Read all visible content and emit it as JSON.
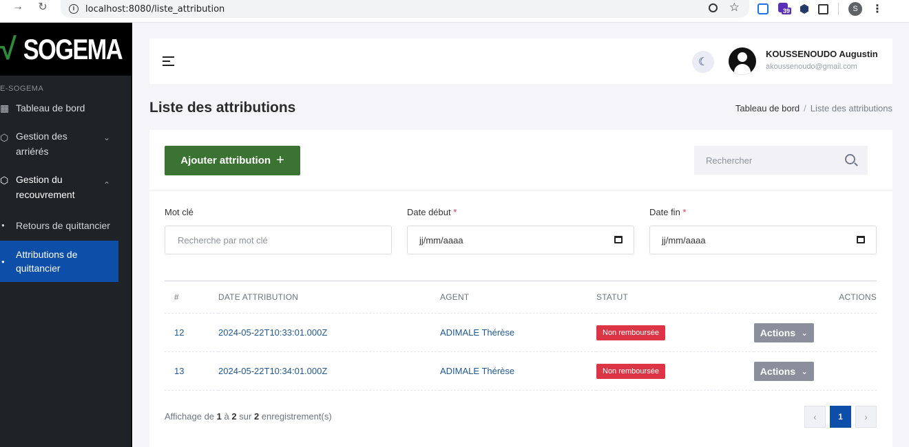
{
  "browser": {
    "url": "localhost:8080/liste_attribution",
    "ext_badge": "39",
    "profile_letter": "S"
  },
  "sidebar": {
    "logo": "SOGEMA",
    "caption": "E-SOGEMA",
    "items": [
      {
        "label": "Tableau de bord"
      },
      {
        "label_line1": "Gestion des",
        "label_line2": "arriérés"
      },
      {
        "label_line1": "Gestion du",
        "label_line2": "recouvrement"
      }
    ],
    "sub_items": [
      {
        "label": "Retours de quittancier"
      },
      {
        "label_line1": "Attributions de",
        "label_line2": "quittancier"
      }
    ]
  },
  "header": {
    "user_name": "KOUSSENOUDO Augustin",
    "user_email": "akoussenoudo@gmail.com"
  },
  "page": {
    "title": "Liste des attributions",
    "breadcrumb_home": "Tableau de bord",
    "breadcrumb_sep": "/",
    "breadcrumb_current": "Liste des attributions"
  },
  "toolbar": {
    "add_label": "Ajouter attribution",
    "add_plus": "+",
    "search_placeholder": "Rechercher"
  },
  "filters": {
    "keyword_label": "Mot clé",
    "keyword_placeholder": "Recherche par mot clé",
    "start_label": "Date début",
    "end_label": "Date fin",
    "required_mark": "*",
    "date_placeholder": "jj/mm/aaaa"
  },
  "table": {
    "headers": [
      "#",
      "DATE ATTRIBUTION",
      "AGENT",
      "STATUT",
      "ACTIONS"
    ],
    "rows": [
      {
        "id": "12",
        "date": "2024-05-22T10:33:01.000Z",
        "agent": "ADIMALE Thérèse",
        "status": "Non remboursée",
        "action": "Actions"
      },
      {
        "id": "13",
        "date": "2024-05-22T10:34:01.000Z",
        "agent": "ADIMALE Thérèse",
        "status": "Non remboursée",
        "action": "Actions"
      }
    ]
  },
  "footer": {
    "prefix": "Affichage de",
    "from": "1",
    "to_word": "à",
    "to": "2",
    "of_word": "sur",
    "total": "2",
    "suffix": "enregistrement(s)",
    "current_page": "1"
  },
  "colors": {
    "primary": "#0d4fa8",
    "add_button": "#3b7432",
    "badge_danger": "#dc3545",
    "sidebar_bg": "#1f2226"
  }
}
